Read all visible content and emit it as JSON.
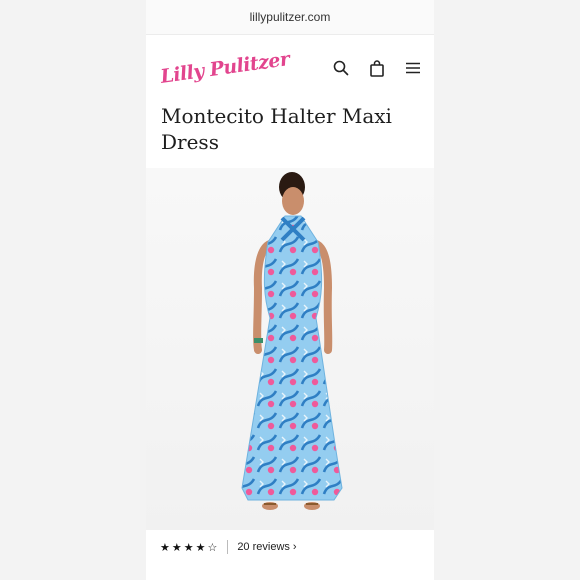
{
  "browser": {
    "url": "lillypulitzer.com"
  },
  "header": {
    "logo_text": "Lilly Pulitzer",
    "icons": [
      "search-icon",
      "bag-icon",
      "menu-icon"
    ],
    "brand_color": "#e2458e"
  },
  "product": {
    "title": "Montecito Halter Maxi Dress",
    "rating": 4.5,
    "rating_stars": "★★★★☆",
    "reviews_label": "20 reviews",
    "dress_colors": [
      "#8fc7ec",
      "#2f7fc4",
      "#ef5a9a"
    ]
  }
}
